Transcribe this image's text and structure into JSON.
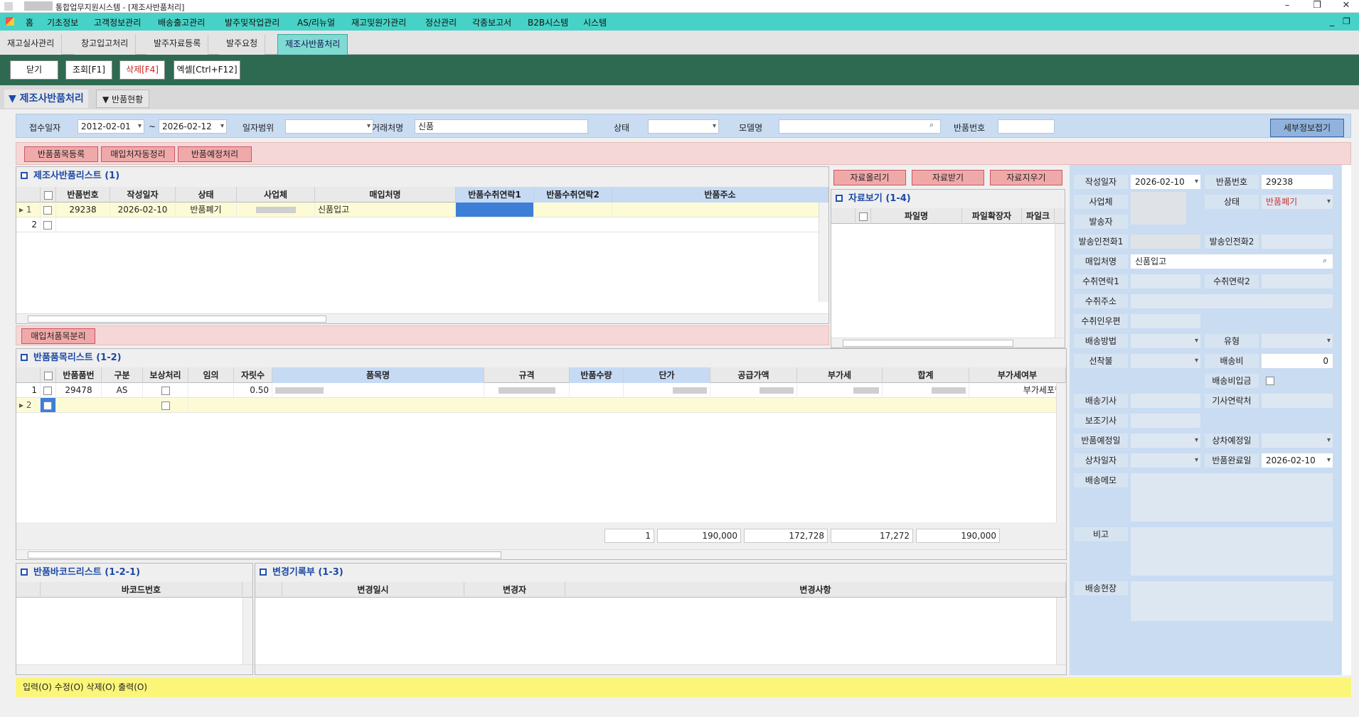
{
  "window": {
    "title": "통합업무지원시스템 - [제조사반품처리]",
    "min": "–",
    "restore": "❐",
    "close": "✕"
  },
  "menu": [
    "홈",
    "기초정보",
    "고객정보관리",
    "배송출고관리",
    "발주및작업관리",
    "AS/리뉴얼",
    "재고및원가관리",
    "정산관리",
    "각종보고서",
    "B2B시스템",
    "시스템"
  ],
  "tabs": [
    "재고실사관리",
    "창고입고처리",
    "발주자료등록",
    "발주요청",
    "제조사반품처리"
  ],
  "toolbar": {
    "close": "닫기",
    "search": "조회[F1]",
    "delete": "삭제[F4]",
    "excel": "엑셀[Ctrl+F12]"
  },
  "section": {
    "title": "▼ 제조사반품처리",
    "tab2": "▼ 반품현황"
  },
  "filter": {
    "receipt_date_label": "접수일자",
    "date_from": "2012-02-01",
    "tilde": "~",
    "date_to": "2026-02-12",
    "date_range_label": "일자범위",
    "date_range_value": "",
    "vendor_label": "거래처명",
    "vendor_value": "신품",
    "status_label": "상태",
    "status_value": "",
    "model_label": "모델명",
    "model_value": "",
    "return_no_label": "반품번호",
    "return_no_value": "",
    "detail_button": "세부정보접기"
  },
  "pink_buttons": [
    "반품품목등록",
    "매입처자동정리",
    "반품예정처리"
  ],
  "return_list": {
    "title": "제조사반품리스트 (1)",
    "columns": [
      "반품번호",
      "작성일자",
      "상태",
      "사업체",
      "매입처명",
      "반품수취연락1",
      "반품수취연락2",
      "반품주소"
    ],
    "rows": [
      {
        "num": "1",
        "no": "29238",
        "date": "2026-02-10",
        "status": "반품폐기",
        "biz": "",
        "vendor": "신품입고",
        "c1": "",
        "c2": "",
        "addr": ""
      },
      {
        "num": "2",
        "no": "",
        "date": "",
        "status": "",
        "biz": "",
        "vendor": "",
        "c1": "",
        "c2": "",
        "addr": ""
      }
    ]
  },
  "file_buttons": [
    "자료올리기",
    "자료받기",
    "자료지우기"
  ],
  "file_view": {
    "title": "자료보기 (1-4)",
    "columns": [
      "파일명",
      "파일확장자",
      "파일크"
    ]
  },
  "split_button": "매입처품목분리",
  "item_list": {
    "title": "반품품목리스트 (1-2)",
    "columns": [
      "반품품번",
      "구분",
      "보상처리",
      "임의",
      "자릿수",
      "품목명",
      "규격",
      "반품수량",
      "단가",
      "공급가액",
      "부가세",
      "합계",
      "부가세여부"
    ],
    "rows": [
      {
        "num": "1",
        "no": "29478",
        "type": "AS",
        "digits": "0.50",
        "vat_flag": "부가세포함"
      },
      {
        "num": "2",
        "no": "",
        "type": "",
        "digits": "",
        "vat_flag": ""
      }
    ],
    "totals": {
      "qty": "1",
      "price": "190,000",
      "supply": "172,728",
      "vat": "17,272",
      "total": "190,000"
    }
  },
  "barcode_list": {
    "title": "반품바코드리스트 (1-2-1)",
    "columns": [
      "바코드번호"
    ]
  },
  "change_log": {
    "title": "변경기록부 (1-3)",
    "columns": [
      "변경일시",
      "변경자",
      "변경사항"
    ]
  },
  "detail": {
    "write_date_label": "작성일자",
    "write_date": "2026-02-10",
    "return_no_label": "반품번호",
    "return_no": "29238",
    "biz_label": "사업체",
    "status_label": "상태",
    "status": "반품폐기",
    "sender_label": "발송자",
    "sender_phone1_label": "발송인전화1",
    "sender_phone2_label": "발송인전화2",
    "vendor_label": "매입처명",
    "vendor": "신품입고",
    "recv1_label": "수취연락1",
    "recv2_label": "수취연락2",
    "recv_addr_label": "수취주소",
    "recv_zip_label": "수취인우편",
    "ship_method_label": "배송방법",
    "type_label": "유형",
    "prepay_label": "선착불",
    "ship_fee_label": "배송비",
    "ship_fee": "0",
    "ship_fee_paid_label": "배송비입금",
    "driver_label": "배송기사",
    "driver_phone_label": "기사연락처",
    "assist_label": "보조기사",
    "return_plan_label": "반품예정일",
    "pickup_plan_label": "상차예정일",
    "pickup_date_label": "상차일자",
    "return_done_label": "반품완료일",
    "return_done": "2026-02-10",
    "ship_memo_label": "배송메모",
    "remark_label": "비고",
    "site_label": "배송현장"
  },
  "status_bar": "입력(O) 수정(O) 삭제(O) 출력(O)"
}
